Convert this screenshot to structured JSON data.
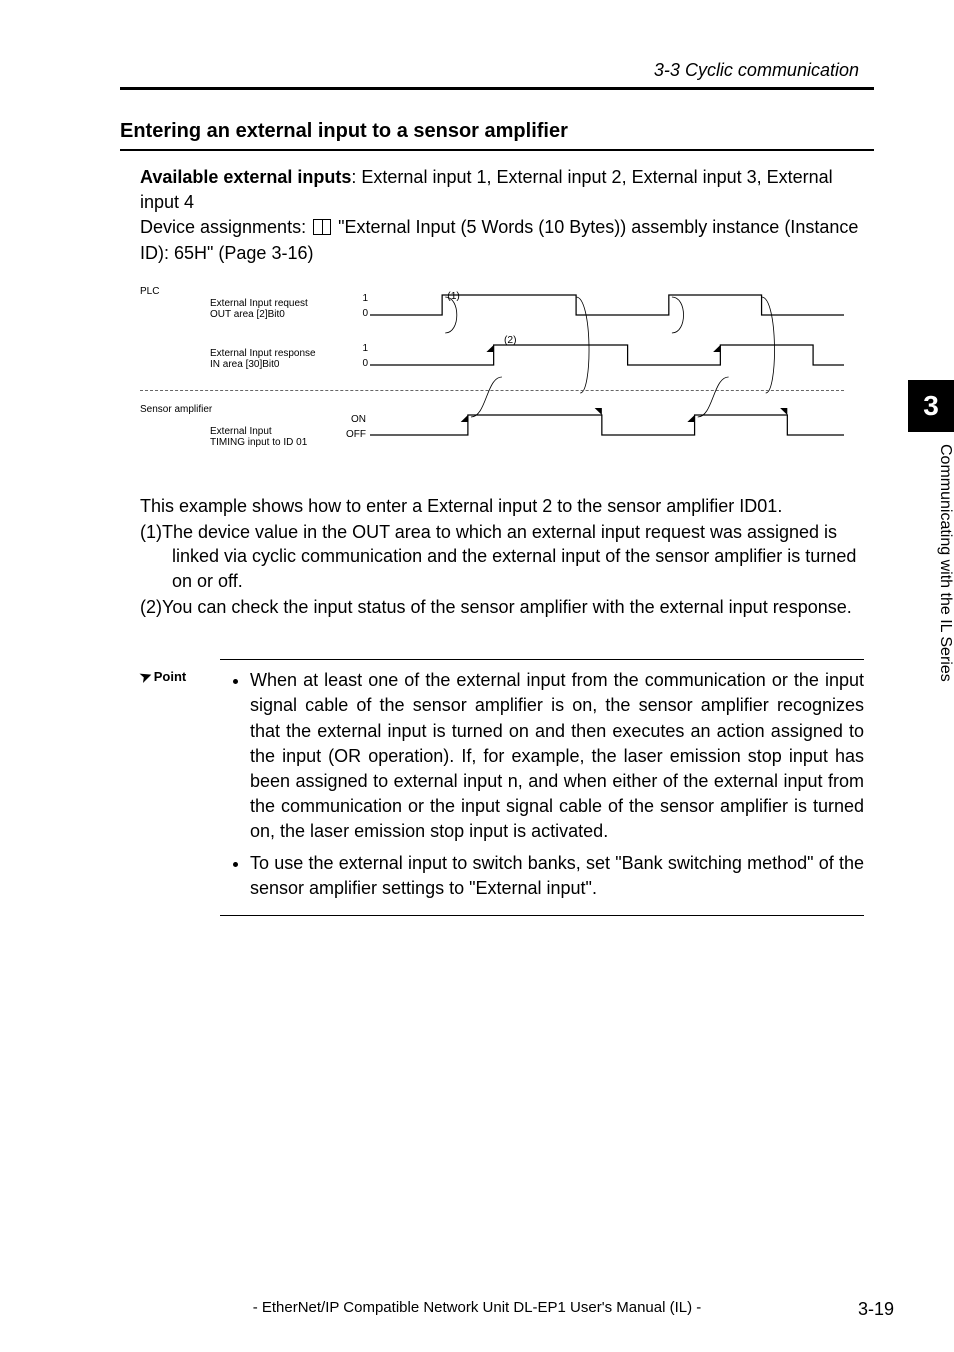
{
  "breadcrumb": "3-3 Cyclic communication",
  "heading": "Entering an external input to a sensor amplifier",
  "intro": {
    "available_label": "Available external inputs",
    "available_text": ": External input 1, External input 2, External input 3, External input 4",
    "device_text_pre": "Device assignments: ",
    "device_text_post": " \"External Input (5 Words (10 Bytes)) assembly instance (Instance ID): 65H\" (Page 3-16)"
  },
  "timing": {
    "plc_label": "PLC",
    "sig1": {
      "name": "External Input request",
      "area": "OUT area [2]Bit0",
      "hi": "1",
      "lo": "0"
    },
    "sig2": {
      "name": "External Input response",
      "area": "IN area [30]Bit0",
      "hi": "1",
      "lo": "0"
    },
    "sensor_label": "Sensor amplifier",
    "sig3": {
      "name": "External Input",
      "sub": "TIMING input to ID 01",
      "on": "ON",
      "off": "OFF"
    },
    "ann1": "(1)",
    "ann2": "(2)"
  },
  "explain": {
    "intro": "This example shows how to enter a External input 2 to the sensor amplifier ID01.",
    "p1": "(1)The device value in the OUT area to which an external input request was assigned is linked via cyclic communication and the external input of the sensor amplifier is turned on or off.",
    "p2": "(2)You can check the input status of the sensor amplifier with the external input response."
  },
  "point": {
    "label": "Point",
    "b1": "When at least one of the external input from the communication or the input signal cable of the sensor amplifier is on, the sensor amplifier recognizes that the external input is turned on and then executes an action assigned to the input (OR operation). If, for example, the laser emission stop input has been assigned to external input n, and when either of the external input from the communication or the input signal cable of the sensor amplifier is turned on, the laser emission stop input is activated.",
    "b2": "To use the external input to switch banks, set \"Bank switching method\" of the sensor amplifier settings to \"External input\"."
  },
  "side": {
    "chapter": "3",
    "label": "Communicating with the IL Series"
  },
  "footer": {
    "center": "- EtherNet/IP Compatible Network Unit DL-EP1 User's Manual (IL) -",
    "page_major": "3-",
    "page_minor": "19"
  }
}
